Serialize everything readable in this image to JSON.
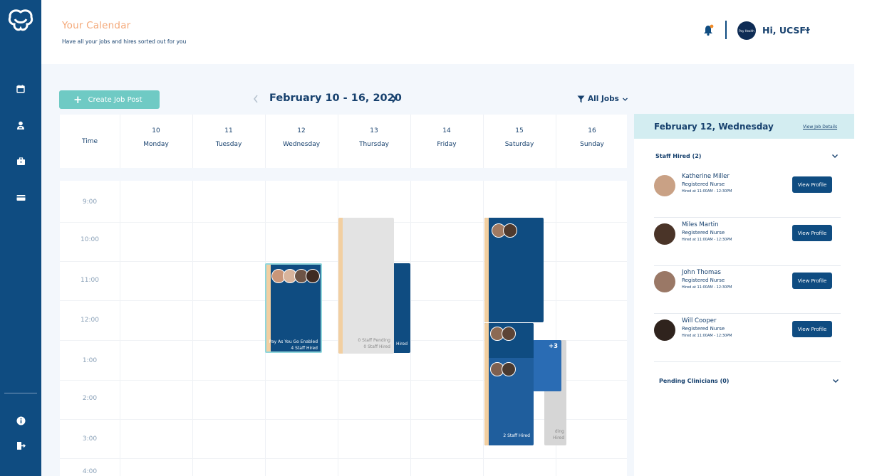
{
  "header": {
    "title": "Your Calendar",
    "subtitle": "Have all your jobs and hires sorted out for you",
    "org_logo_text": "Pay Health",
    "greeting": "Hi, UCSF!"
  },
  "sidebar": {
    "nav_icons": [
      "calendar-icon",
      "user-icon",
      "briefcase-icon",
      "card-icon"
    ],
    "bottom_icons": [
      "info-icon",
      "logout-icon"
    ]
  },
  "toolbar": {
    "create_label": "Create Job Post",
    "week_range": "February 10 - 16, 2020",
    "filter_label": "All Jobs"
  },
  "calendar": {
    "time_header": "Time",
    "days": [
      {
        "num": "10",
        "name": "Monday"
      },
      {
        "num": "11",
        "name": "Tuesday"
      },
      {
        "num": "12",
        "name": "Wednesday"
      },
      {
        "num": "13",
        "name": "Thursday"
      },
      {
        "num": "14",
        "name": "Friday"
      },
      {
        "num": "15",
        "name": "Saturday"
      },
      {
        "num": "16",
        "name": "Sunday"
      }
    ],
    "times": [
      "9:00",
      "10:00",
      "11:00",
      "12:00",
      "1:00",
      "2:00",
      "3:00",
      "4:00"
    ],
    "events": {
      "wed_line1": "Pay As You Go Enabled",
      "wed_line2": "4 Staff Hired",
      "thu_gray_line1": "0 Staff Pending",
      "thu_gray_line2": "0 Staff Hired",
      "thu_blue_partial": "Hired",
      "sat_more": "+3",
      "sat_hired": "2 Staff Hired",
      "sat_gray_partial_1": "ding",
      "sat_gray_partial_2": "Hired"
    }
  },
  "details": {
    "date": "February 12, Wednesday",
    "view_link": "View Job Details",
    "staff_section": "Staff Hired (2)",
    "pending_section": "Pending Clinicians (0)",
    "view_profile_label": "View Profile",
    "staff": [
      {
        "name": "Katherine Miller",
        "role": "Registered Nurse",
        "hired": "Hired at 11:00AM - 12:30PM"
      },
      {
        "name": "Miles Martin",
        "role": "Registered Nurse",
        "hired": "Hired at 11:00AM - 12:30PM"
      },
      {
        "name": "John Thomas",
        "role": "Registered Nurse",
        "hired": "Hired at 11:00AM - 12:30PM"
      },
      {
        "name": "Will Cooper",
        "role": "Registered Nurse",
        "hired": "Hired at 11:00AM - 12:30PM"
      }
    ]
  },
  "colors": {
    "primary": "#0f4c81",
    "accent_teal": "#6fcac4",
    "title_orange": "#f4a878",
    "event_stripe": "#f2cfa1",
    "notification_dot": "#f28c28"
  }
}
